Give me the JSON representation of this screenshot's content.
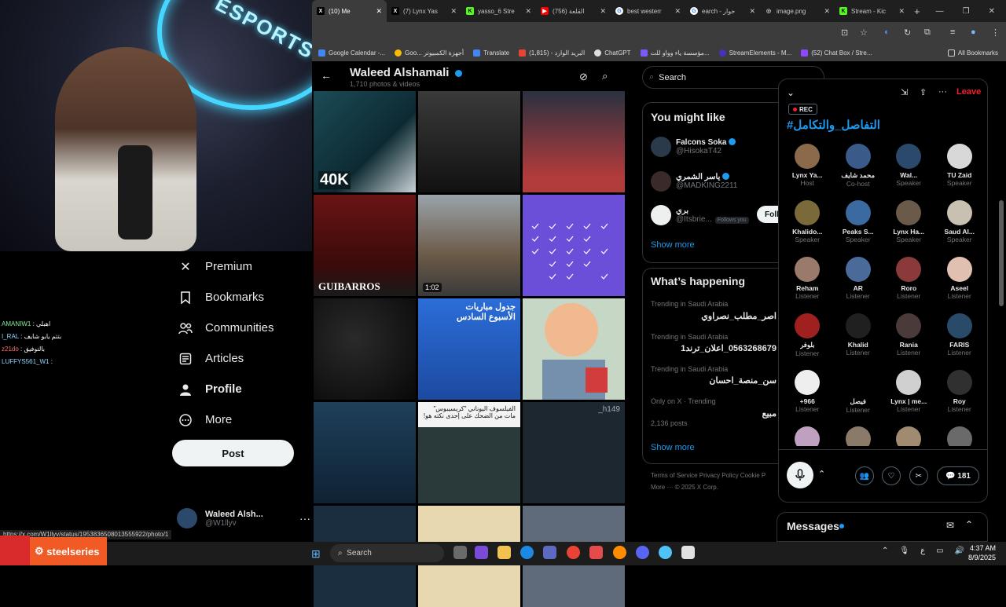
{
  "stream": {
    "neon_text": "ESPORTS",
    "chat": [
      {
        "user": "AMANIW1",
        "msg": "اهبلي"
      },
      {
        "user": "I_RAL",
        "msg": "بتتم يابو شايف"
      },
      {
        "user": "z21do",
        "msg": "بالتوفيق"
      },
      {
        "user": "LUFFYS561_W1",
        "msg": ""
      }
    ],
    "banner": "steelseries",
    "status_url": "https://x.com/W1llyv/status/1953836508013555922/photo/1"
  },
  "nav": {
    "items": [
      {
        "label": "Premium",
        "icon": "x-logo-icon"
      },
      {
        "label": "Bookmarks",
        "icon": "bookmark-icon"
      },
      {
        "label": "Communities",
        "icon": "communities-icon"
      },
      {
        "label": "Articles",
        "icon": "articles-icon"
      },
      {
        "label": "Profile",
        "icon": "profile-icon"
      },
      {
        "label": "More",
        "icon": "more-circle-icon"
      }
    ],
    "post_label": "Post",
    "account_name": "Waleed Alsh...",
    "account_handle": "@W1llyv"
  },
  "browser": {
    "tabs": [
      {
        "title": "(10) Me",
        "icon": "X"
      },
      {
        "title": "(7) Lynx Yas",
        "icon": "X"
      },
      {
        "title": "yasso_6 Stre",
        "icon": "K"
      },
      {
        "title": "(756) القلعة",
        "icon": "▶"
      },
      {
        "title": "best westerr",
        "icon": "G"
      },
      {
        "title": "earch - خوار",
        "icon": "G"
      },
      {
        "title": "image.png",
        "icon": "◎"
      },
      {
        "title": "Stream - Kic",
        "icon": "K"
      }
    ],
    "bookmarks": [
      "Google Calendar -...",
      "Goo... أجهزة الكمبيوتر",
      "Translate",
      "البريد الوارد - (1,815)",
      "ChatGPT",
      "مؤسسة ياء وواو للت...",
      "StreamElements - M...",
      "(52) Chat Box / Stre..."
    ],
    "all_bookmarks": "All Bookmarks"
  },
  "media": {
    "profile_name": "Waleed Alshamali",
    "count": "1,710 photos & videos",
    "tiles": [
      {
        "cap": "40K",
        "ar": ""
      },
      {
        "cap": "",
        "ar": ""
      },
      {
        "cap": "",
        "ar": ""
      },
      {
        "cap": "GUIBARROS",
        "ar": ""
      },
      {
        "cap": "",
        "dur": "1:02",
        "ar": ""
      },
      {
        "cap": "",
        "ar": ""
      },
      {
        "cap": "",
        "ar": ""
      },
      {
        "cap": "",
        "ar": "جدول مباريات الأسبوع السادس"
      },
      {
        "cap": "",
        "ar": ""
      },
      {
        "cap": "",
        "ar": ""
      },
      {
        "cap": "",
        "ar": "الفيلسوف اليوناني \"كريسيبوس\" مات من الضحك على إحدى نكته هو!"
      },
      {
        "cap": "",
        "ar": "h149_"
      }
    ]
  },
  "right": {
    "search_placeholder": "Search",
    "ymal_title": "You might like",
    "suggestions": [
      {
        "name": "Falcons Soka",
        "handle": "@HisokaT42",
        "follows_you": ""
      },
      {
        "name": "ياسر الشمري",
        "handle": "@MADKING2211",
        "follows_you": ""
      },
      {
        "name": "بري",
        "handle": "@Itsbrie...",
        "follows_you": "Follows you"
      }
    ],
    "follow_label": "Foll",
    "show_more": "Show more",
    "whap_title": "What’s happening",
    "trends": [
      {
        "ctx": "Trending in Saudi Arabia",
        "text": "اصر_مطلب_نصراوي"
      },
      {
        "ctx": "Trending in Saudi Arabia",
        "text": "0563268679_اعلان_ترند1"
      },
      {
        "ctx": "Trending in Saudi Arabia",
        "text": "سن_منصة_احسان"
      },
      {
        "ctx": "Only on X · Trending",
        "text": "مبيع"
      }
    ],
    "posts": "2,136 posts",
    "footer": "Terms of Service   Privacy Policy   Cookie P",
    "footer2": "More ···  © 2025 X Corp."
  },
  "space": {
    "leave": "Leave",
    "rec": "REC",
    "title": "#التفاصل_والتكامل",
    "participants": [
      {
        "name": "Lynx Ya...",
        "role": "Host",
        "color": "#8a6a4a"
      },
      {
        "name": "محمد شايف",
        "role": "Co-host",
        "color": "#3a5a8a"
      },
      {
        "name": "Wal...",
        "role": "Speaker",
        "color": "#2b4a6b"
      },
      {
        "name": "TU Zaid",
        "role": "Speaker",
        "color": "#d8d8d8"
      },
      {
        "name": "Khalido...",
        "role": "Speaker",
        "color": "#7a6a3a"
      },
      {
        "name": "Peaks S...",
        "role": "Speaker",
        "color": "#3a6aa0"
      },
      {
        "name": "Lynx Ha...",
        "role": "Speaker",
        "color": "#6a5a4a"
      },
      {
        "name": "Saud Al...",
        "role": "Speaker",
        "color": "#c8c0b0"
      },
      {
        "name": "Reham",
        "role": "Listener",
        "color": "#9a7a6a"
      },
      {
        "name": "AR",
        "role": "Listener",
        "color": "#4a6a9a"
      },
      {
        "name": "Roro",
        "role": "Listener",
        "color": "#8a3a3a"
      },
      {
        "name": "Aseel",
        "role": "Listener",
        "color": "#e0c0b0"
      },
      {
        "name": "بلوفر",
        "role": "Listener",
        "color": "#a02020"
      },
      {
        "name": "Khalid",
        "role": "Listener",
        "color": "#202020"
      },
      {
        "name": "Rania",
        "role": "Listener",
        "color": "#4a3a3a"
      },
      {
        "name": "FARIS",
        "role": "Listener",
        "color": "#2a4a6a"
      },
      {
        "name": "+966",
        "role": "Listener",
        "color": "#eeeeee"
      },
      {
        "name": "فيصل",
        "role": "Listener",
        "color": "#000000"
      },
      {
        "name": "Lynx | me...",
        "role": "Listener",
        "color": "#d0d0d0"
      },
      {
        "name": "Roy",
        "role": "Listener",
        "color": "#303030"
      },
      {
        "name": "",
        "role": "",
        "color": "#c0a0c0"
      },
      {
        "name": "",
        "role": "",
        "color": "#8a7a6a"
      },
      {
        "name": "",
        "role": "",
        "color": "#a08a70"
      },
      {
        "name": "",
        "role": "",
        "color": "#6a6a6a"
      }
    ],
    "count": "181"
  },
  "messages": {
    "title": "Messages"
  },
  "taskbar": {
    "search": "Search",
    "time": "4:37 AM",
    "date": "8/9/2025",
    "lang": "ع"
  }
}
